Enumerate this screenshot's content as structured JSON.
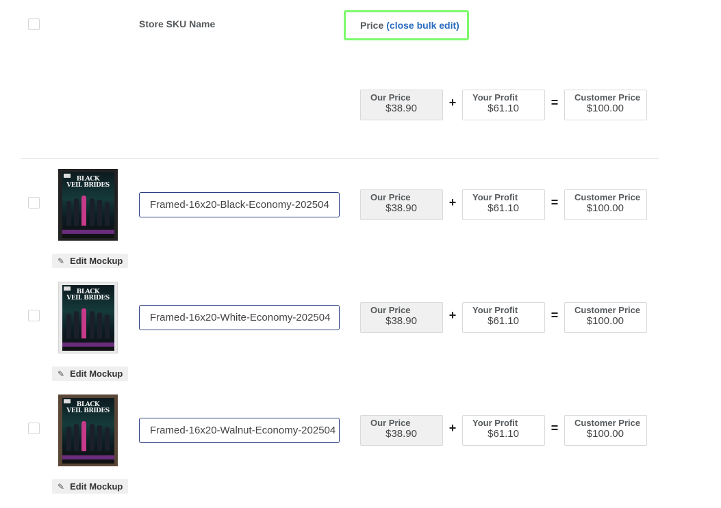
{
  "header": {
    "sku_column": "Store SKU Name",
    "price_column": "Price",
    "close_bulk_edit": "(close bulk edit)"
  },
  "bulk_price": {
    "our_price_label": "Our Price",
    "our_price": "$38.90",
    "plus": "+",
    "profit_label": "Your Profit",
    "profit": "$61.10",
    "equals": "=",
    "customer_label": "Customer Price",
    "customer_price": "$100.00"
  },
  "rows": [
    {
      "sku_name": "Framed-16x20-Black-Economy-202504",
      "frame_color": "#222222",
      "edit_label": "Edit Mockup",
      "our_price_label": "Our Price",
      "our_price": "$38.90",
      "profit_label": "Your Profit",
      "profit": "$61.10",
      "customer_label": "Customer Price",
      "customer_price": "$100.00"
    },
    {
      "sku_name": "Framed-16x20-White-Economy-202504",
      "frame_color": "#e8e8e8",
      "edit_label": "Edit Mockup",
      "our_price_label": "Our Price",
      "our_price": "$38.90",
      "profit_label": "Your Profit",
      "profit": "$61.10",
      "customer_label": "Customer Price",
      "customer_price": "$100.00"
    },
    {
      "sku_name": "Framed-16x20-Walnut-Economy-202504",
      "frame_color": "#5a4636",
      "edit_label": "Edit Mockup",
      "our_price_label": "Our Price",
      "our_price": "$38.90",
      "profit_label": "Your Profit",
      "profit": "$61.10",
      "customer_label": "Customer Price",
      "customer_price": "$100.00"
    }
  ],
  "poster": {
    "title_line1": "BLACK",
    "title_line2": "VEIL BRIDES"
  },
  "colors": {
    "highlight_border": "#7dfa6c",
    "link": "#2a6cbf",
    "input_border": "#2b3f84"
  }
}
